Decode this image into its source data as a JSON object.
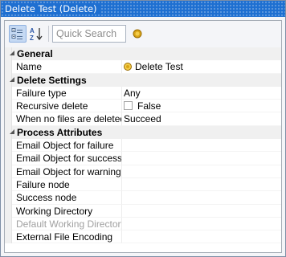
{
  "window": {
    "title": "Delete Test (Delete)"
  },
  "toolbar": {
    "categorized_icon": "categorized-view-icon",
    "alphabetical_icon": "sort-alphabetical-icon",
    "search_placeholder": "Quick Search",
    "help_icon": "coin-help-icon"
  },
  "grid": {
    "general": {
      "label": "General",
      "name": {
        "label": "Name",
        "value": "Delete Test",
        "value_icon": "coin-icon"
      }
    },
    "delete_settings": {
      "label": "Delete Settings",
      "failure_type": {
        "label": "Failure type",
        "value": "Any"
      },
      "recursive_delete": {
        "label": "Recursive delete",
        "value": "False",
        "checked": false
      },
      "when_no_files": {
        "label": "When no files are deleted:",
        "value": "Succeed"
      }
    },
    "process_attributes": {
      "label": "Process Attributes",
      "items": [
        {
          "label": "Email Object for failure",
          "value": ""
        },
        {
          "label": "Email Object for success",
          "value": ""
        },
        {
          "label": "Email Object for warning",
          "value": ""
        },
        {
          "label": "Failure node",
          "value": ""
        },
        {
          "label": "Success node",
          "value": ""
        },
        {
          "label": "Working Directory",
          "value": ""
        },
        {
          "label": "Default Working Directory",
          "value": "",
          "disabled": true
        },
        {
          "label": "External File Encoding",
          "value": ""
        }
      ]
    }
  },
  "colors": {
    "titlebar": "#1e6fd1",
    "category_background": "#f0f0f0",
    "selected_toolbar_button": "#c5d9f3",
    "disabled_text": "#a0a0a0"
  }
}
